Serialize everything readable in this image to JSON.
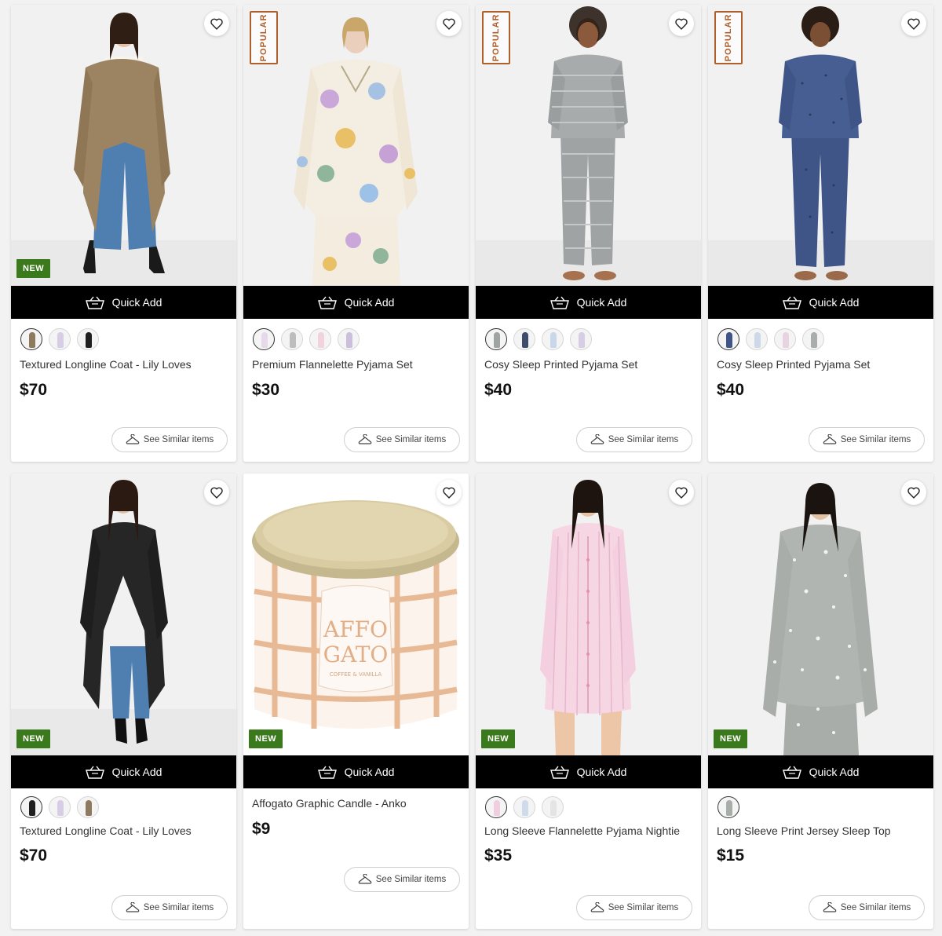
{
  "labels": {
    "quick_add": "Quick Add",
    "see_similar": "See Similar items",
    "badge_new": "NEW",
    "badge_popular": "POPULAR"
  },
  "products": [
    {
      "title": "Textured Longline Coat - Lily Loves",
      "price": "$70",
      "badge": "NEW",
      "popular": false,
      "image": "model-brown-coat",
      "swatches": [
        "brown",
        "lilac",
        "black"
      ]
    },
    {
      "title": "Premium Flannelette Pyjama Set",
      "price": "$30",
      "badge": "",
      "popular": true,
      "image": "model-floral-pyjamas",
      "swatches": [
        "floral",
        "grey",
        "pink",
        "lilac"
      ]
    },
    {
      "title": "Cosy Sleep Printed Pyjama Set",
      "price": "$40",
      "badge": "",
      "popular": true,
      "image": "model-grey-stripe-pyjamas",
      "swatches": [
        "grey",
        "navy",
        "blue",
        "lilac"
      ]
    },
    {
      "title": "Cosy Sleep Printed Pyjama Set",
      "price": "$40",
      "badge": "",
      "popular": true,
      "image": "model-navy-pyjamas",
      "swatches": [
        "navy",
        "light-blue",
        "pink",
        "grey"
      ]
    },
    {
      "title": "Textured Longline Coat - Lily Loves",
      "price": "$70",
      "badge": "NEW",
      "popular": false,
      "image": "model-black-coat",
      "swatches": [
        "black",
        "lilac",
        "brown"
      ]
    },
    {
      "title": "Affogato Graphic Candle - Anko",
      "price": "$9",
      "badge": "NEW",
      "popular": false,
      "image": "affogato-candle-jar",
      "candle_text": [
        "AFFO",
        "GATO"
      ],
      "candle_subtext": "COFFEE & VANILLA",
      "swatches": []
    },
    {
      "title": "Long Sleeve Flannelette Pyjama Nightie",
      "price": "$35",
      "badge": "NEW",
      "popular": false,
      "image": "model-pink-nightie",
      "swatches": [
        "pink",
        "light-blue",
        "white"
      ]
    },
    {
      "title": "Long Sleeve Print Jersey Sleep Top",
      "price": "$15",
      "badge": "NEW",
      "popular": false,
      "image": "model-grey-star-top",
      "swatches": [
        "grey"
      ]
    }
  ],
  "colors": {
    "quick_add_bg": "#000000",
    "new_badge": "#3b7a1c",
    "popular_badge": "#b05e2a",
    "page_bg": "#f2f2f2"
  }
}
